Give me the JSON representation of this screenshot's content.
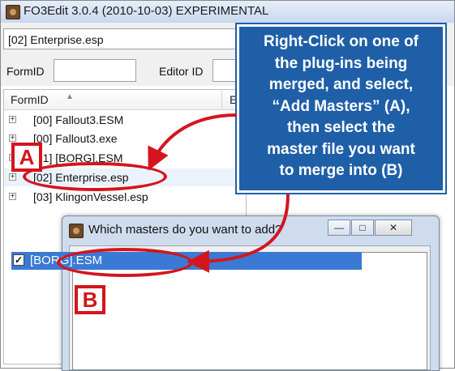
{
  "window": {
    "title": "FO3Edit 3.0.4 (2010-10-03) EXPERIMENTAL",
    "plugin_field": "[02] Enterprise.esp"
  },
  "filter": {
    "formid_label": "FormID",
    "editorid_label": "Editor ID"
  },
  "tree": {
    "columns": [
      "FormID",
      "E"
    ],
    "rows": [
      {
        "expander": "+",
        "label": "[00] Fallout3.ESM"
      },
      {
        "expander": "+",
        "label": "[00] Fallout3.exe"
      },
      {
        "expander": "+",
        "label": "[01] [BORG].ESM"
      },
      {
        "expander": "+",
        "label": "[02] Enterprise.esp"
      },
      {
        "expander": "+",
        "label": "[03] KlingonVessel.esp"
      }
    ]
  },
  "callout": {
    "lines": [
      "Right-Click on one of",
      "the plug-ins being",
      "merged, and select,",
      "“Add Masters” (A),",
      "then select the",
      "master file you want",
      "to merge into (B)"
    ],
    "color": "#1f5fa8"
  },
  "badges": {
    "a": "A",
    "b": "B"
  },
  "dialog": {
    "title": "Which masters do you want to add?",
    "minimize": "—",
    "maximize": "□",
    "close": "✕",
    "items": [
      {
        "checked": "✓",
        "label": "[BORG].ESM"
      }
    ]
  },
  "colors": {
    "annotation_red": "#d4151d",
    "selection_blue": "#3a7ad4"
  }
}
